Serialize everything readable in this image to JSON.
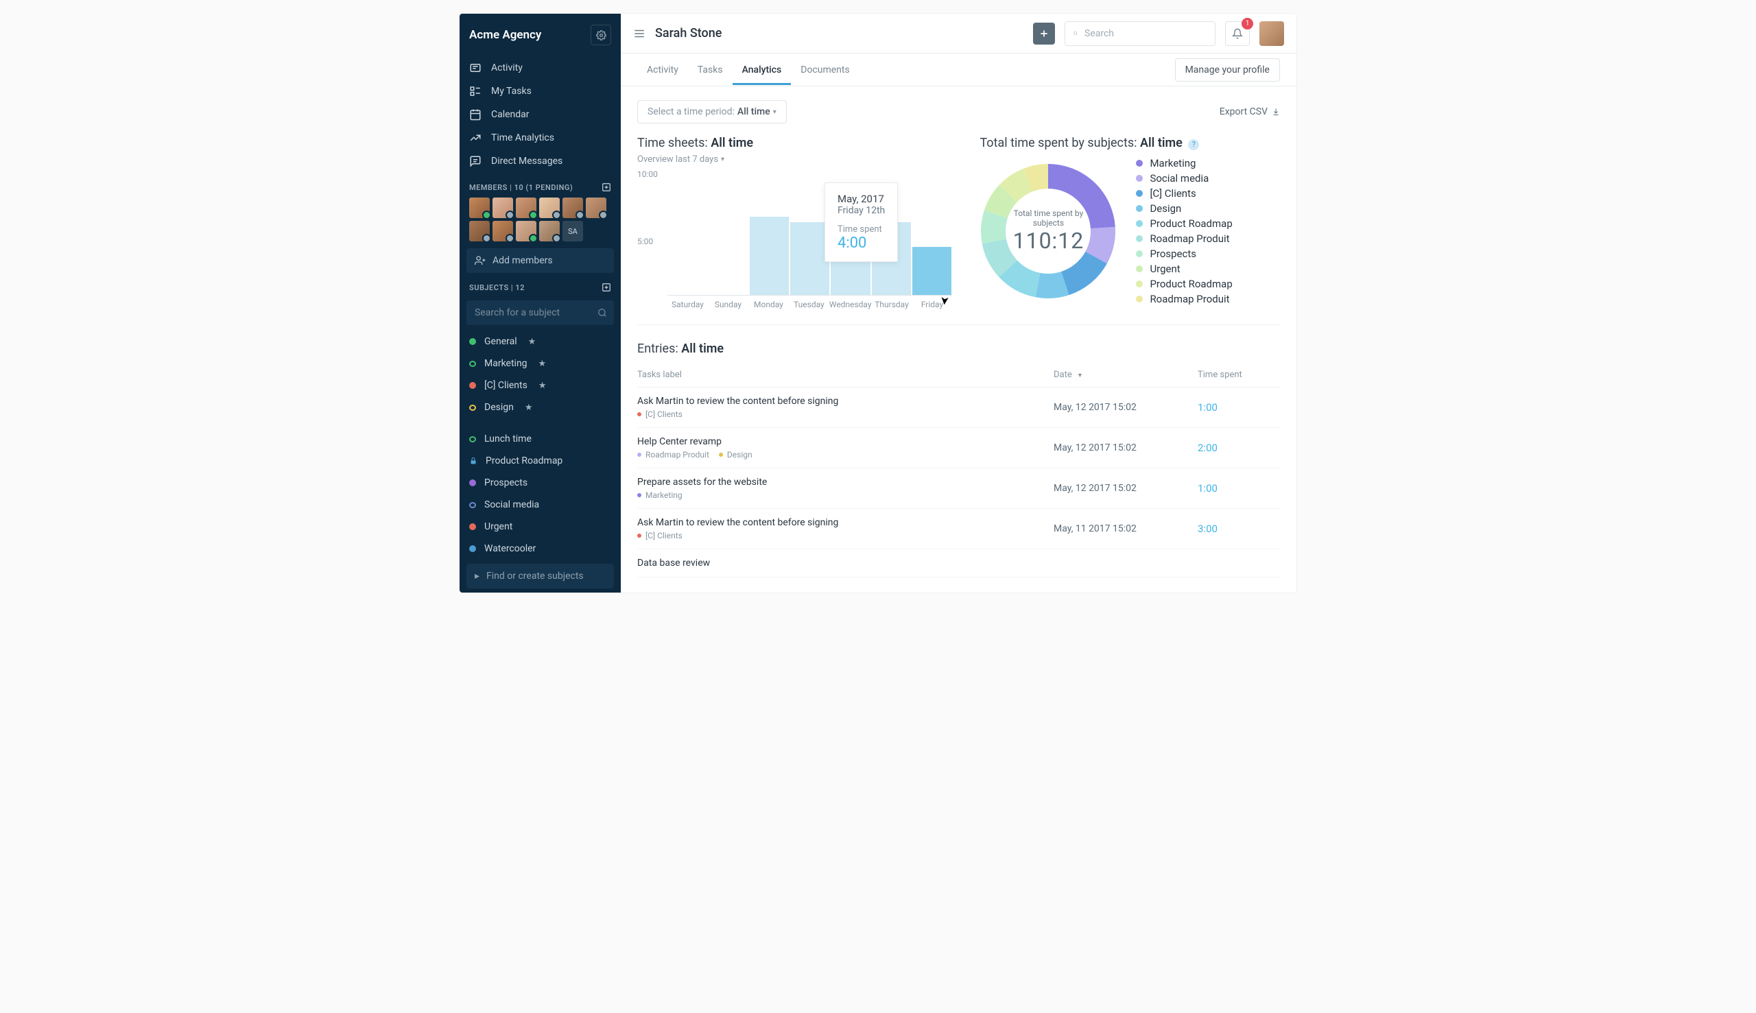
{
  "sidebar": {
    "org_name": "Acme Agency",
    "nav": [
      {
        "label": "Activity"
      },
      {
        "label": "My Tasks"
      },
      {
        "label": "Calendar"
      },
      {
        "label": "Time Analytics"
      },
      {
        "label": "Direct Messages"
      }
    ],
    "members_label": "MEMBERS | 10 (1 PENDING)",
    "add_members_label": "Add members",
    "sa_initials": "SA",
    "subjects_label": "SUBJECTS | 12",
    "subject_search_placeholder": "Search for a subject",
    "subjects_starred": [
      {
        "label": "General",
        "color": "#3fbf6e",
        "hollow": false
      },
      {
        "label": "Marketing",
        "color": "#3fbf6e",
        "hollow": true
      },
      {
        "label": "[C] Clients",
        "color": "#e66a5a",
        "hollow": false
      },
      {
        "label": "Design",
        "color": "#e6c24a",
        "hollow": true
      }
    ],
    "subjects_other": [
      {
        "label": "Lunch time",
        "color": "#3fbf6e",
        "hollow": true,
        "icon": null
      },
      {
        "label": "Product Roadmap",
        "icon": "lock"
      },
      {
        "label": "Prospects",
        "color": "#9a6bd4",
        "hollow": false
      },
      {
        "label": "Social media",
        "color": "#6b8bd4",
        "hollow": true
      },
      {
        "label": "Urgent",
        "color": "#e66a5a",
        "hollow": false
      },
      {
        "label": "Watercooler",
        "color": "#4a9bcf",
        "hollow": false
      }
    ],
    "find_create_label": "Find or create subjects"
  },
  "header": {
    "title": "Sarah Stone",
    "search_placeholder": "Search",
    "notification_count": "1"
  },
  "tabs": [
    {
      "label": "Activity"
    },
    {
      "label": "Tasks"
    },
    {
      "label": "Analytics"
    },
    {
      "label": "Documents"
    }
  ],
  "active_tab_index": 2,
  "manage_profile_label": "Manage your profile",
  "period_picker": {
    "prefix": "Select a time period:",
    "value": "All time"
  },
  "export_label": "Export CSV",
  "timesheet": {
    "title_prefix": "Time sheets:",
    "title_value": "All time",
    "sub": "Overview last 7 days",
    "y_labels": [
      "10:00",
      "5:00"
    ],
    "tooltip": {
      "month": "May, 2017",
      "day": "Friday 12th",
      "label": "Time spent",
      "value": "4:00"
    }
  },
  "chart_data": {
    "type": "bar",
    "categories": [
      "Saturday",
      "Sunday",
      "Monday",
      "Tuesday",
      "Wednesday",
      "Thursday",
      "Friday"
    ],
    "values": [
      0,
      0,
      6.5,
      6.0,
      7.0,
      6.0,
      4.0
    ],
    "ylim": [
      0,
      10
    ],
    "ylabel": "",
    "xlabel": "",
    "highlight_index": 6
  },
  "donut": {
    "title_prefix": "Total time spent by subjects:",
    "title_value": "All time",
    "center_label": "Total time spent by subjects",
    "center_value": "110:12",
    "series": [
      {
        "name": "Marketing",
        "color": "#8b7fe3",
        "value": 24
      },
      {
        "name": "Social media",
        "color": "#b8aef0",
        "value": 9
      },
      {
        "name": "[C] Clients",
        "color": "#5aa7e0",
        "value": 12
      },
      {
        "name": "Design",
        "color": "#7cc8ea",
        "value": 8
      },
      {
        "name": "Product Roadmap",
        "color": "#8fd9e8",
        "value": 10
      },
      {
        "name": "Roadmap Produit",
        "color": "#a8e3df",
        "value": 9
      },
      {
        "name": "Prospects",
        "color": "#b8edd3",
        "value": 8
      },
      {
        "name": "Urgent",
        "color": "#cdefb6",
        "value": 7
      },
      {
        "name": "Product Roadmap",
        "color": "#e0eeab",
        "value": 7
      },
      {
        "name": "Roadmap Produit",
        "color": "#ede9a0",
        "value": 6
      }
    ]
  },
  "entries": {
    "title_prefix": "Entries:",
    "title_value": "All time",
    "columns": {
      "task": "Tasks label",
      "date": "Date",
      "time": "Time spent"
    },
    "rows": [
      {
        "title": "Ask Martin to review the content before signing",
        "tags": [
          {
            "label": "[C] Clients",
            "color": "#e66a5a"
          }
        ],
        "date": "May, 12 2017 15:02",
        "time": "1:00"
      },
      {
        "title": "Help Center revamp",
        "tags": [
          {
            "label": "Roadmap Produit",
            "color": "#b8aef0"
          },
          {
            "label": "Design",
            "color": "#e6c24a"
          }
        ],
        "date": "May, 12 2017 15:02",
        "time": "2:00"
      },
      {
        "title": "Prepare assets for the website",
        "tags": [
          {
            "label": "Marketing",
            "color": "#8b7fe3"
          }
        ],
        "date": "May, 12 2017 15:02",
        "time": "1:00"
      },
      {
        "title": "Ask Martin to review the content before signing",
        "tags": [
          {
            "label": "[C] Clients",
            "color": "#e66a5a"
          }
        ],
        "date": "May, 11 2017 15:02",
        "time": "3:00"
      },
      {
        "title": "Data base review",
        "tags": [],
        "date": "",
        "time": ""
      }
    ]
  }
}
